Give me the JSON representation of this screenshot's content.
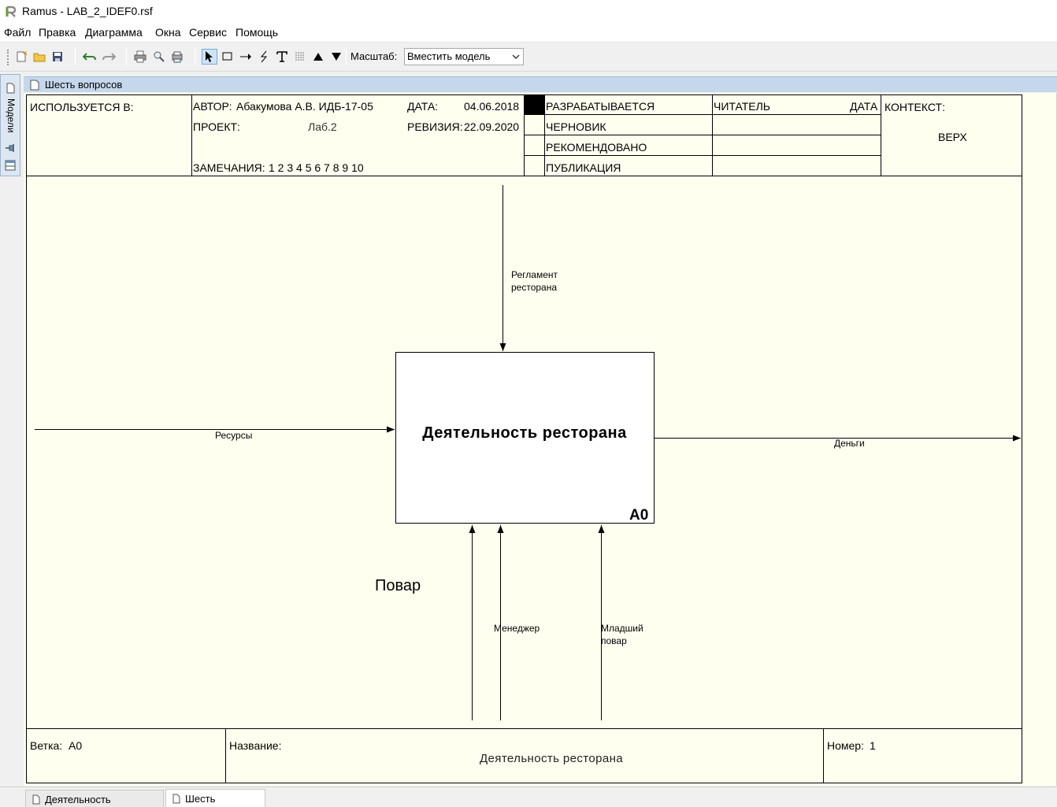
{
  "window": {
    "title": "Ramus - LAB_2_IDEF0.rsf"
  },
  "menu": [
    "Файл",
    "Правка",
    "Диаграмма",
    "Окна",
    "Сервис",
    "Помощь"
  ],
  "toolbar": {
    "zoom_label": "Масштаб:",
    "zoom_value": "Вместить модель"
  },
  "left_dock": {
    "label": "Модели"
  },
  "diagram": {
    "tab_title": "Шесть вопросов",
    "header": {
      "used_in": "ИСПОЛЬЗУЕТСЯ В:",
      "author_label": "АВТОР:",
      "author": "Абакумова А.В. ИДБ-17-05",
      "project_label": "ПРОЕКТ:",
      "project": "Лаб.2",
      "notes_label": "ЗАМЕЧАНИЯ:",
      "notes": "1 2 3 4 5 6 7 8 9 10",
      "date_label": "ДАТА:",
      "date": "04.06.2018",
      "revision_label": "РЕВИЗИЯ:",
      "revision": "22.09.2020",
      "statuses": [
        "РАЗРАБАТЫВАЕТСЯ",
        "ЧЕРНОВИК",
        "РЕКОМЕНДОВАНО",
        "ПУБЛИКАЦИЯ"
      ],
      "reader_label": "ЧИТАТЕЛЬ",
      "reader_date_label": "ДАТА",
      "context_label": "КОНТЕКСТ:",
      "context_value": "ВЕРХ"
    },
    "activity": {
      "name": "Деятельность ресторана",
      "number": "A0"
    },
    "arrows": {
      "control": "Регламент ресторана",
      "input": "Ресурсы",
      "output": "Деньги",
      "mechanism_1": "Менеджер",
      "mechanism_2": "Младший повар",
      "floating": "Повар"
    },
    "footer": {
      "node_label": "Ветка:",
      "node": "A0",
      "title_label": "Название:",
      "title": "Деятельность ресторана",
      "number_label": "Номер:",
      "number": "1"
    }
  },
  "tabs": [
    {
      "label": "Деятельность ресторана",
      "active": false
    },
    {
      "label": "Шесть вопросов",
      "active": true
    }
  ]
}
